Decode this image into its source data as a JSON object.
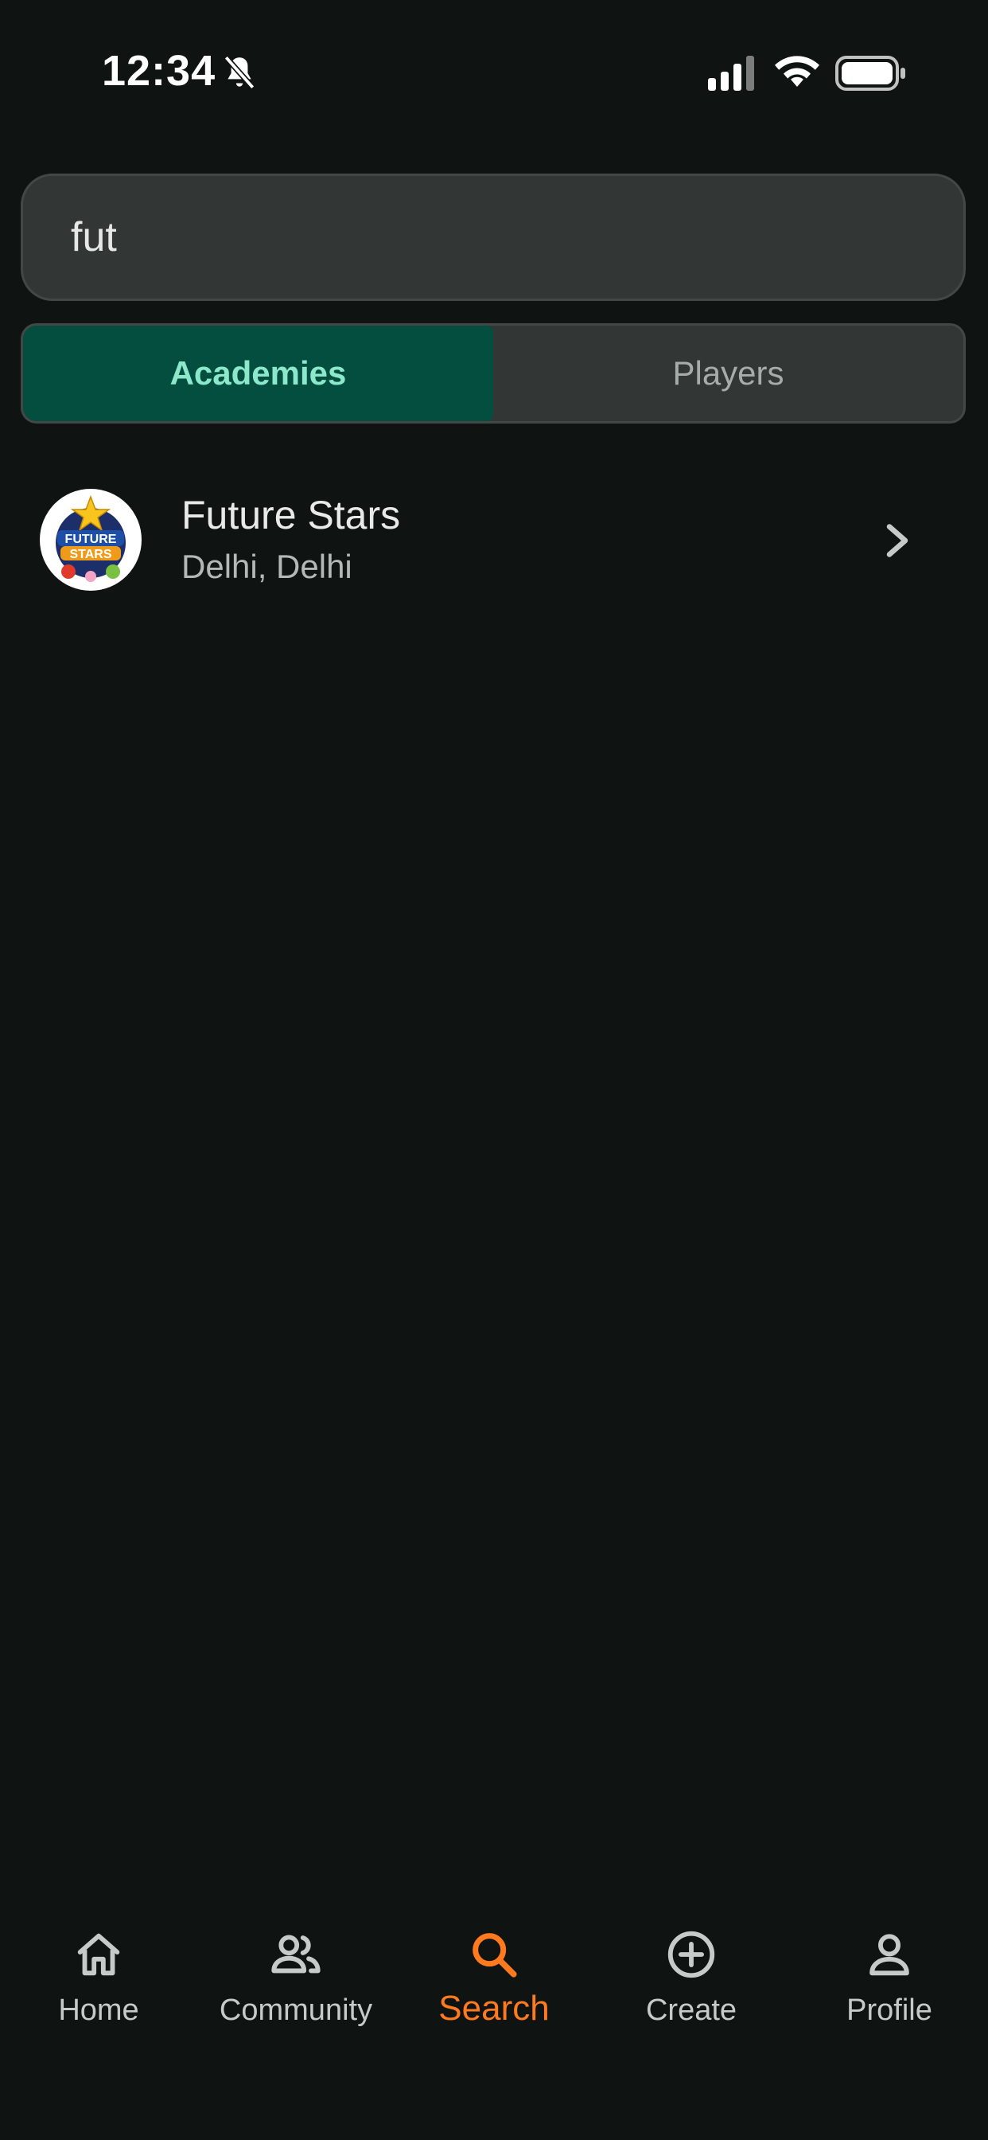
{
  "status_bar": {
    "time": "12:34"
  },
  "search": {
    "value": "fut",
    "placeholder": ""
  },
  "tabs": [
    {
      "label": "Academies",
      "active": true
    },
    {
      "label": "Players",
      "active": false
    }
  ],
  "results": [
    {
      "title": "Future Stars",
      "subtitle": "Delhi, Delhi",
      "logo_text_top": "FUTURE",
      "logo_text_bottom": "STARS"
    }
  ],
  "bottom_nav": {
    "items": [
      {
        "label": "Home",
        "icon": "home-icon",
        "active": false
      },
      {
        "label": "Community",
        "icon": "community-icon",
        "active": false
      },
      {
        "label": "Search",
        "icon": "search-icon",
        "active": true
      },
      {
        "label": "Create",
        "icon": "plus-circle-icon",
        "active": false
      },
      {
        "label": "Profile",
        "icon": "person-icon",
        "active": false
      }
    ]
  },
  "colors": {
    "background": "#0f1413",
    "accent": "#ff7a1f",
    "tab_active_bg": "#044e3f",
    "tab_active_text": "#8be8cb"
  }
}
